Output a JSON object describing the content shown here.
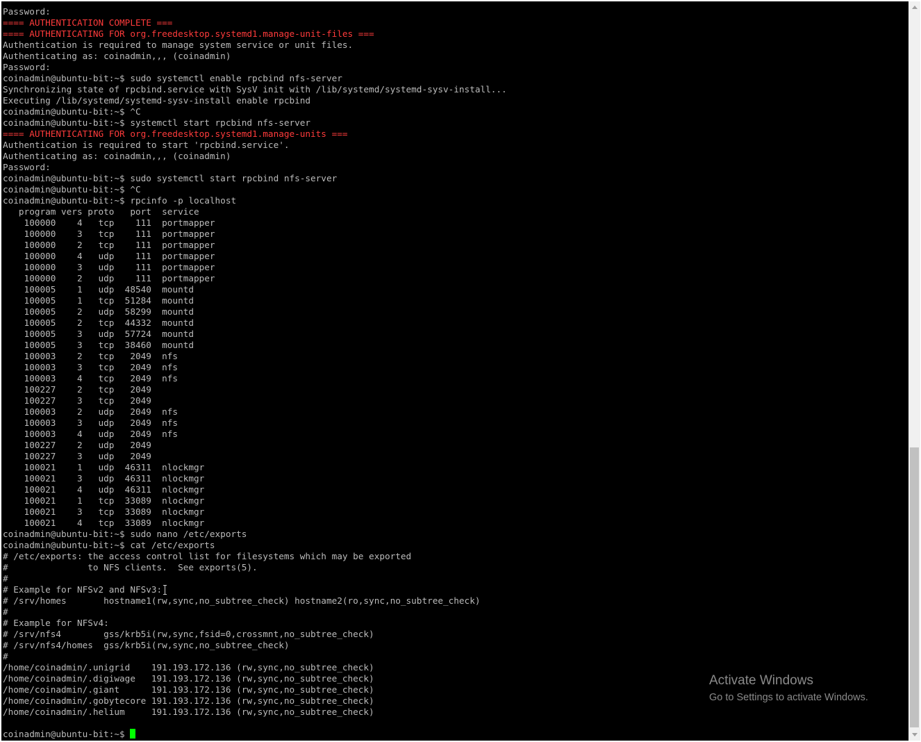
{
  "colors": {
    "background": "#000000",
    "text": "#bbbbbb",
    "highlight": "#ff3b3b",
    "cursor": "#00ff00"
  },
  "terminal": {
    "lines": [
      {
        "text": "Password:",
        "style": "normal"
      },
      {
        "text": "==== AUTHENTICATION COMPLETE ===",
        "style": "red"
      },
      {
        "text": "==== AUTHENTICATING FOR org.freedesktop.systemd1.manage-unit-files ===",
        "style": "red"
      },
      {
        "text": "Authentication is required to manage system service or unit files.",
        "style": "normal"
      },
      {
        "text": "Authenticating as: coinadmin,,, (coinadmin)",
        "style": "normal"
      },
      {
        "text": "Password:",
        "style": "normal"
      },
      {
        "text": "coinadmin@ubuntu-bit:~$ sudo systemctl enable rpcbind nfs-server",
        "style": "normal"
      },
      {
        "text": "Synchronizing state of rpcbind.service with SysV init with /lib/systemd/systemd-sysv-install...",
        "style": "normal"
      },
      {
        "text": "Executing /lib/systemd/systemd-sysv-install enable rpcbind",
        "style": "normal"
      },
      {
        "text": "coinadmin@ubuntu-bit:~$ ^C",
        "style": "normal"
      },
      {
        "text": "coinadmin@ubuntu-bit:~$ systemctl start rpcbind nfs-server",
        "style": "normal"
      },
      {
        "text": "==== AUTHENTICATING FOR org.freedesktop.systemd1.manage-units ===",
        "style": "red"
      },
      {
        "text": "Authentication is required to start 'rpcbind.service'.",
        "style": "normal"
      },
      {
        "text": "Authenticating as: coinadmin,,, (coinadmin)",
        "style": "normal"
      },
      {
        "text": "Password:",
        "style": "normal"
      },
      {
        "text": "coinadmin@ubuntu-bit:~$ sudo systemctl start rpcbind nfs-server",
        "style": "normal"
      },
      {
        "text": "coinadmin@ubuntu-bit:~$ ^C",
        "style": "normal"
      },
      {
        "text": "coinadmin@ubuntu-bit:~$ rpcinfo -p localhost",
        "style": "normal"
      },
      {
        "text": "   program vers proto   port  service",
        "style": "normal"
      },
      {
        "text": "    100000    4   tcp    111  portmapper",
        "style": "normal"
      },
      {
        "text": "    100000    3   tcp    111  portmapper",
        "style": "normal"
      },
      {
        "text": "    100000    2   tcp    111  portmapper",
        "style": "normal"
      },
      {
        "text": "    100000    4   udp    111  portmapper",
        "style": "normal"
      },
      {
        "text": "    100000    3   udp    111  portmapper",
        "style": "normal"
      },
      {
        "text": "    100000    2   udp    111  portmapper",
        "style": "normal"
      },
      {
        "text": "    100005    1   udp  48540  mountd",
        "style": "normal"
      },
      {
        "text": "    100005    1   tcp  51284  mountd",
        "style": "normal"
      },
      {
        "text": "    100005    2   udp  58299  mountd",
        "style": "normal"
      },
      {
        "text": "    100005    2   tcp  44332  mountd",
        "style": "normal"
      },
      {
        "text": "    100005    3   udp  57724  mountd",
        "style": "normal"
      },
      {
        "text": "    100005    3   tcp  38460  mountd",
        "style": "normal"
      },
      {
        "text": "    100003    2   tcp   2049  nfs",
        "style": "normal"
      },
      {
        "text": "    100003    3   tcp   2049  nfs",
        "style": "normal"
      },
      {
        "text": "    100003    4   tcp   2049  nfs",
        "style": "normal"
      },
      {
        "text": "    100227    2   tcp   2049",
        "style": "normal"
      },
      {
        "text": "    100227    3   tcp   2049",
        "style": "normal"
      },
      {
        "text": "    100003    2   udp   2049  nfs",
        "style": "normal"
      },
      {
        "text": "    100003    3   udp   2049  nfs",
        "style": "normal"
      },
      {
        "text": "    100003    4   udp   2049  nfs",
        "style": "normal"
      },
      {
        "text": "    100227    2   udp   2049",
        "style": "normal"
      },
      {
        "text": "    100227    3   udp   2049",
        "style": "normal"
      },
      {
        "text": "    100021    1   udp  46311  nlockmgr",
        "style": "normal"
      },
      {
        "text": "    100021    3   udp  46311  nlockmgr",
        "style": "normal"
      },
      {
        "text": "    100021    4   udp  46311  nlockmgr",
        "style": "normal"
      },
      {
        "text": "    100021    1   tcp  33089  nlockmgr",
        "style": "normal"
      },
      {
        "text": "    100021    3   tcp  33089  nlockmgr",
        "style": "normal"
      },
      {
        "text": "    100021    4   tcp  33089  nlockmgr",
        "style": "normal"
      },
      {
        "text": "coinadmin@ubuntu-bit:~$ sudo nano /etc/exports",
        "style": "normal"
      },
      {
        "text": "coinadmin@ubuntu-bit:~$ cat /etc/exports",
        "style": "normal"
      },
      {
        "text": "# /etc/exports: the access control list for filesystems which may be exported",
        "style": "normal"
      },
      {
        "text": "#               to NFS clients.  See exports(5).",
        "style": "normal"
      },
      {
        "text": "#",
        "style": "normal"
      },
      {
        "text": "# Example for NFSv2 and NFSv3:",
        "style": "normal",
        "ibeam": true
      },
      {
        "text": "# /srv/homes       hostname1(rw,sync,no_subtree_check) hostname2(ro,sync,no_subtree_check)",
        "style": "normal"
      },
      {
        "text": "#",
        "style": "normal"
      },
      {
        "text": "# Example for NFSv4:",
        "style": "normal"
      },
      {
        "text": "# /srv/nfs4        gss/krb5i(rw,sync,fsid=0,crossmnt,no_subtree_check)",
        "style": "normal"
      },
      {
        "text": "# /srv/nfs4/homes  gss/krb5i(rw,sync,no_subtree_check)",
        "style": "normal"
      },
      {
        "text": "#",
        "style": "normal"
      },
      {
        "text": "/home/coinadmin/.unigrid    191.193.172.136 (rw,sync,no_subtree_check)",
        "style": "normal"
      },
      {
        "text": "/home/coinadmin/.digiwage   191.193.172.136 (rw,sync,no_subtree_check)",
        "style": "normal"
      },
      {
        "text": "/home/coinadmin/.giant      191.193.172.136 (rw,sync,no_subtree_check)",
        "style": "normal"
      },
      {
        "text": "/home/coinadmin/.gobytecore 191.193.172.136 (rw,sync,no_subtree_check)",
        "style": "normal"
      },
      {
        "text": "/home/coinadmin/.helium     191.193.172.136 (rw,sync,no_subtree_check)",
        "style": "normal"
      },
      {
        "text": "",
        "style": "normal"
      },
      {
        "text": "coinadmin@ubuntu-bit:~$ ",
        "style": "normal",
        "cursor": true
      }
    ]
  },
  "watermark": {
    "title": "Activate Windows",
    "subtitle": "Go to Settings to activate Windows."
  }
}
